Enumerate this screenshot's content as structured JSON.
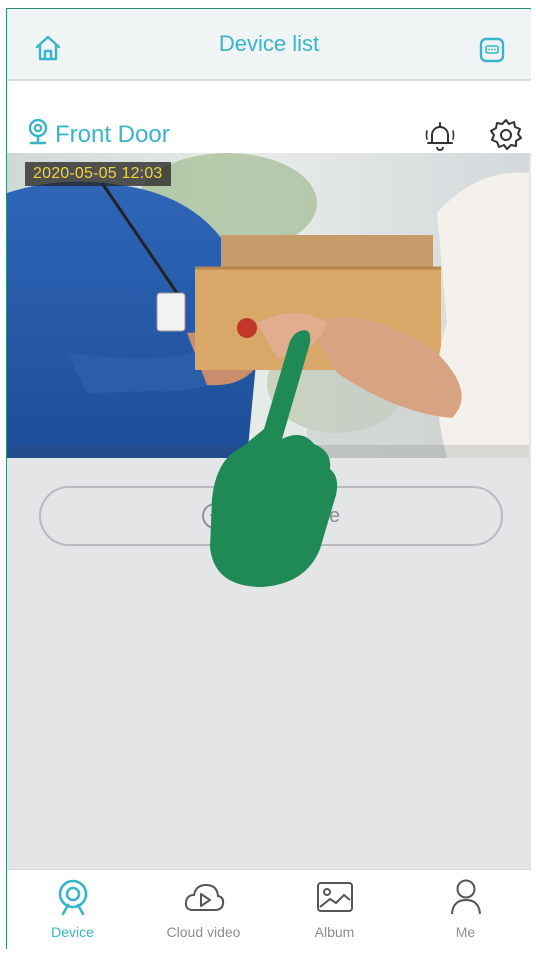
{
  "header": {
    "title": "Device list"
  },
  "device": {
    "name": "Front Door",
    "timestamp": "2020-05-05   12:03"
  },
  "add_device": {
    "label": "Add Device"
  },
  "tabs": [
    {
      "label": "Device",
      "icon": "camera-icon",
      "active": true
    },
    {
      "label": "Cloud video",
      "icon": "cloud-play-icon",
      "active": false
    },
    {
      "label": "Album",
      "icon": "image-icon",
      "active": false
    },
    {
      "label": "Me",
      "icon": "person-icon",
      "active": false
    }
  ],
  "colors": {
    "accent": "#38b5cc",
    "timestamp_text": "#f3d438",
    "hand_overlay": "#1f8a55",
    "inactive": "#8b8f93"
  }
}
